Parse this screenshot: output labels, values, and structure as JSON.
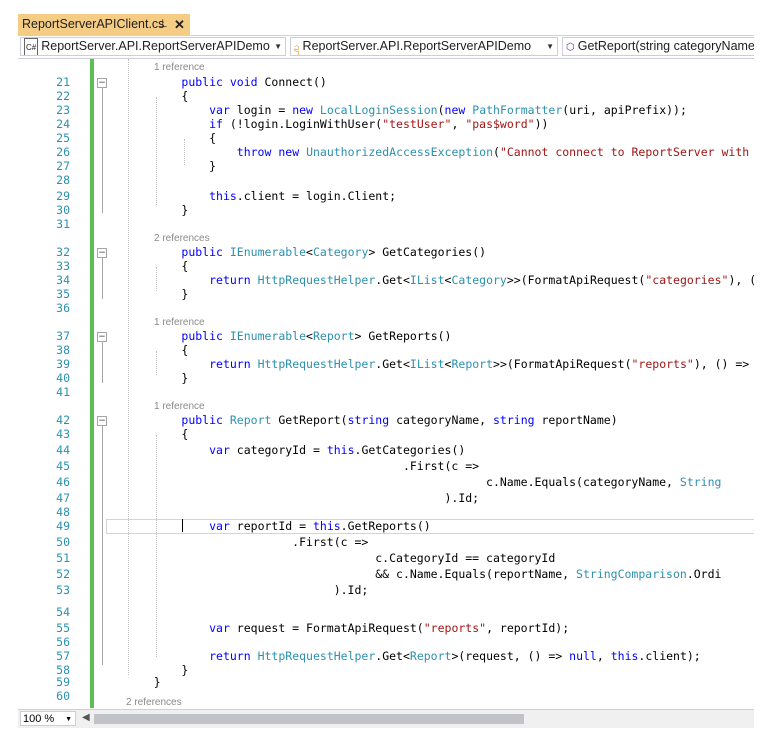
{
  "tab": {
    "title": "ReportServerAPIClient.cs",
    "pin_icon": "pin-icon",
    "close_glyph": "✕"
  },
  "nav": {
    "project": "ReportServer.API.ReportServerAPIDemo",
    "type": "ReportServer.API.ReportServerAPIDemo",
    "member": "GetReport(string categoryName,",
    "project_icon": "C#"
  },
  "lens": {
    "connect": "1 reference",
    "categories": "2 references",
    "reports": "1 reference",
    "getreport": "1 reference",
    "next": "2 references"
  },
  "lines": [
    {
      "n": "21",
      "t": [
        [
          "        ",
          ""
        ],
        [
          "public",
          "kw"
        ],
        [
          " ",
          ""
        ],
        [
          "void",
          "kw"
        ],
        [
          " Connect()",
          ""
        ]
      ]
    },
    {
      "n": "22",
      "t": [
        [
          "        {",
          ""
        ]
      ]
    },
    {
      "n": "23",
      "t": [
        [
          "            ",
          ""
        ],
        [
          "var",
          "kw"
        ],
        [
          " login = ",
          ""
        ],
        [
          "new",
          "kw"
        ],
        [
          " ",
          ""
        ],
        [
          "LocalLoginSession",
          "ty"
        ],
        [
          "(",
          ""
        ],
        [
          "new",
          "kw"
        ],
        [
          " ",
          ""
        ],
        [
          "PathFormatter",
          "ty"
        ],
        [
          "(uri, apiPrefix));",
          ""
        ]
      ]
    },
    {
      "n": "24",
      "t": [
        [
          "            ",
          ""
        ],
        [
          "if",
          "kw"
        ],
        [
          " (!login.LoginWithUser(",
          ""
        ],
        [
          "\"testUser\"",
          "st"
        ],
        [
          ", ",
          ""
        ],
        [
          "\"pas$word\"",
          "st"
        ],
        [
          "))",
          ""
        ]
      ]
    },
    {
      "n": "25",
      "t": [
        [
          "            {",
          ""
        ]
      ]
    },
    {
      "n": "26",
      "t": [
        [
          "                ",
          ""
        ],
        [
          "throw",
          "kw"
        ],
        [
          " ",
          ""
        ],
        [
          "new",
          "kw"
        ],
        [
          " ",
          ""
        ],
        [
          "UnauthorizedAccessException",
          "ty"
        ],
        [
          "(",
          ""
        ],
        [
          "\"Cannot connect to ReportServer with the",
          "st"
        ]
      ]
    },
    {
      "n": "27",
      "t": [
        [
          "            }",
          ""
        ]
      ]
    },
    {
      "n": "28",
      "t": [
        [
          "",
          ""
        ]
      ]
    },
    {
      "n": "29",
      "t": [
        [
          "            ",
          ""
        ],
        [
          "this",
          "kw"
        ],
        [
          ".client = login.Client;",
          ""
        ]
      ]
    },
    {
      "n": "30",
      "t": [
        [
          "        }",
          ""
        ]
      ]
    },
    {
      "n": "31",
      "t": [
        [
          "",
          ""
        ]
      ]
    },
    {
      "n": "32",
      "t": [
        [
          "        ",
          ""
        ],
        [
          "public",
          "kw"
        ],
        [
          " ",
          ""
        ],
        [
          "IEnumerable",
          "ty"
        ],
        [
          "<",
          ""
        ],
        [
          "Category",
          "ty"
        ],
        [
          "> GetCategories()",
          ""
        ]
      ]
    },
    {
      "n": "33",
      "t": [
        [
          "        {",
          ""
        ]
      ]
    },
    {
      "n": "34",
      "t": [
        [
          "            ",
          ""
        ],
        [
          "return",
          "kw"
        ],
        [
          " ",
          ""
        ],
        [
          "HttpRequestHelper",
          "ty"
        ],
        [
          ".Get<",
          ""
        ],
        [
          "IList",
          "ty"
        ],
        [
          "<",
          ""
        ],
        [
          "Category",
          "ty"
        ],
        [
          ">>(FormatApiRequest(",
          ""
        ],
        [
          "\"categories\"",
          "st"
        ],
        [
          "), () =",
          ""
        ]
      ]
    },
    {
      "n": "35",
      "t": [
        [
          "        }",
          ""
        ]
      ]
    },
    {
      "n": "36",
      "t": [
        [
          "",
          ""
        ]
      ]
    },
    {
      "n": "37",
      "t": [
        [
          "        ",
          ""
        ],
        [
          "public",
          "kw"
        ],
        [
          " ",
          ""
        ],
        [
          "IEnumerable",
          "ty"
        ],
        [
          "<",
          ""
        ],
        [
          "Report",
          "ty"
        ],
        [
          "> GetReports()",
          ""
        ]
      ]
    },
    {
      "n": "38",
      "t": [
        [
          "        {",
          ""
        ]
      ]
    },
    {
      "n": "39",
      "t": [
        [
          "            ",
          ""
        ],
        [
          "return",
          "kw"
        ],
        [
          " ",
          ""
        ],
        [
          "HttpRequestHelper",
          "ty"
        ],
        [
          ".Get<",
          ""
        ],
        [
          "IList",
          "ty"
        ],
        [
          "<",
          ""
        ],
        [
          "Report",
          "ty"
        ],
        [
          ">>(FormatApiRequest(",
          ""
        ],
        [
          "\"reports\"",
          "st"
        ],
        [
          "), () => ",
          ""
        ],
        [
          "new",
          "kw"
        ]
      ]
    },
    {
      "n": "40",
      "t": [
        [
          "        }",
          ""
        ]
      ]
    },
    {
      "n": "41",
      "t": [
        [
          "",
          ""
        ]
      ]
    },
    {
      "n": "42",
      "t": [
        [
          "        ",
          ""
        ],
        [
          "public",
          "kw"
        ],
        [
          " ",
          ""
        ],
        [
          "Report",
          "ty"
        ],
        [
          " GetReport(",
          ""
        ],
        [
          "string",
          "kw"
        ],
        [
          " categoryName, ",
          ""
        ],
        [
          "string",
          "kw"
        ],
        [
          " reportName)",
          ""
        ]
      ]
    },
    {
      "n": "43",
      "t": [
        [
          "        {",
          ""
        ]
      ]
    },
    {
      "n": "44",
      "t": [
        [
          "            ",
          ""
        ],
        [
          "var",
          "kw"
        ],
        [
          " categoryId = ",
          ""
        ],
        [
          "this",
          "kw"
        ],
        [
          ".GetCategories()",
          ""
        ]
      ]
    },
    {
      "n": "45",
      "t": [
        [
          "                                        .First(c =>",
          ""
        ]
      ]
    },
    {
      "n": "46",
      "t": [
        [
          "                                                    c.Name.Equals(categoryName, ",
          ""
        ],
        [
          "String",
          "ty"
        ]
      ]
    },
    {
      "n": "47",
      "t": [
        [
          "                                              ).Id;",
          ""
        ]
      ]
    },
    {
      "n": "48",
      "t": [
        [
          "",
          ""
        ]
      ]
    },
    {
      "n": "49",
      "t": [
        [
          "            ",
          ""
        ],
        [
          "var",
          "kw"
        ],
        [
          " reportId = ",
          ""
        ],
        [
          "this",
          "kw"
        ],
        [
          ".GetReports()",
          ""
        ]
      ]
    },
    {
      "n": "50",
      "t": [
        [
          "                        .First(c =>",
          ""
        ]
      ]
    },
    {
      "n": "51",
      "t": [
        [
          "                                    c.CategoryId == categoryId",
          ""
        ]
      ]
    },
    {
      "n": "52",
      "t": [
        [
          "                                    && c.Name.Equals(reportName, ",
          ""
        ],
        [
          "StringComparison",
          "ty"
        ],
        [
          ".Ordi",
          ""
        ]
      ]
    },
    {
      "n": "53",
      "t": [
        [
          "                              ).Id;",
          ""
        ]
      ]
    },
    {
      "n": "54",
      "t": [
        [
          "",
          ""
        ]
      ]
    },
    {
      "n": "55",
      "t": [
        [
          "            ",
          ""
        ],
        [
          "var",
          "kw"
        ],
        [
          " request = FormatApiRequest(",
          ""
        ],
        [
          "\"reports\"",
          "st"
        ],
        [
          ", reportId);",
          ""
        ]
      ]
    },
    {
      "n": "56",
      "t": [
        [
          "",
          ""
        ]
      ]
    },
    {
      "n": "57",
      "t": [
        [
          "            ",
          ""
        ],
        [
          "return",
          "kw"
        ],
        [
          " ",
          ""
        ],
        [
          "HttpRequestHelper",
          "ty"
        ],
        [
          ".Get<",
          ""
        ],
        [
          "Report",
          "ty"
        ],
        [
          ">(request, () => ",
          ""
        ],
        [
          "null",
          "kw"
        ],
        [
          ", ",
          ""
        ],
        [
          "this",
          "kw"
        ],
        [
          ".client);",
          ""
        ]
      ]
    },
    {
      "n": "58",
      "t": [
        [
          "        }",
          ""
        ]
      ]
    },
    {
      "n": "59",
      "t": [
        [
          "    }",
          ""
        ]
      ]
    },
    {
      "n": "60",
      "t": [
        [
          "",
          ""
        ]
      ]
    }
  ],
  "status": {
    "zoom": "100 %"
  },
  "colors": {
    "tab": "#F5CC84",
    "linenumber": "#2B91AF",
    "keyword": "#0000FF",
    "type": "#2B91AF",
    "string": "#A31515",
    "changebar": "#5BBF55"
  }
}
